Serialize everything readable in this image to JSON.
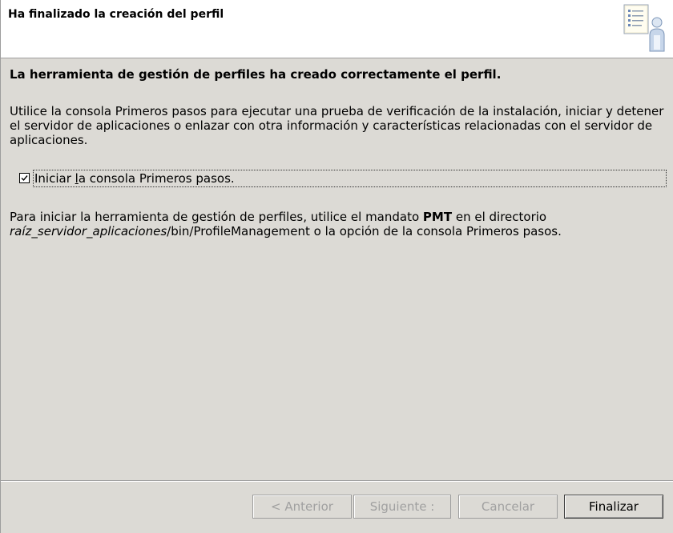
{
  "header": {
    "title": "Ha finalizado la creación del perfil",
    "icon": "profile-wizard-icon"
  },
  "main": {
    "success_message": "La herramienta de gestión de perfiles ha creado correctamente el perfil.",
    "description": "Utilice la consola Primeros pasos para ejecutar una prueba de verificación de la instalación, iniciar y detener el servidor de aplicaciones o enlazar con otra información y características relacionadas con el servidor de aplicaciones.",
    "checkbox": {
      "label_before": "Iniciar ",
      "label_mnemonic": "l",
      "label_after": "a consola Primeros pasos.",
      "checked": true
    },
    "note": {
      "part1": "Para iniciar la herramienta de gestión de perfiles, utilice el mandato ",
      "command": "PMT",
      "part2": " en el directorio",
      "path_italic": "raíz_servidor_aplicaciones",
      "path_rest": "/bin/ProfileManagement o la opción de la consola Primeros pasos."
    }
  },
  "buttons": {
    "back": "< Anterior",
    "next": "Siguiente :",
    "cancel": "Cancelar",
    "finish": "Finalizar"
  }
}
